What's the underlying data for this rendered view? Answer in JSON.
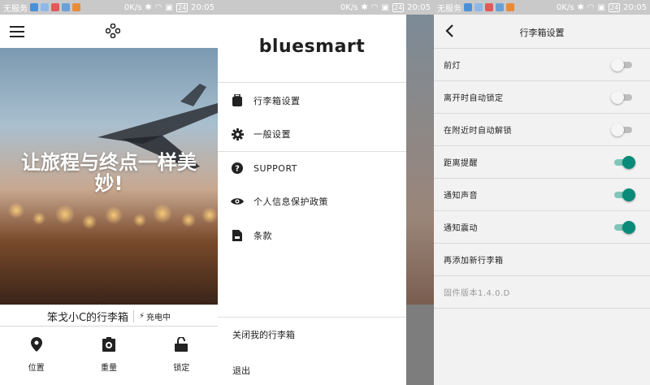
{
  "status": {
    "carrier": "无服务",
    "speed": "0K/s",
    "battery": "24",
    "time": "20:05"
  },
  "colors": {
    "accent": "#0a8a78",
    "accent_track": "#7fc6b9",
    "off_track": "#bdbdbd"
  },
  "home": {
    "hero_text": "让旅程与终点一样美妙!",
    "luggage_name": "笨戈小C的行李箱",
    "charging_label": "充电中",
    "actions": [
      {
        "label": "位置",
        "icon": "location-pin-icon"
      },
      {
        "label": "重量",
        "icon": "scale-icon"
      },
      {
        "label": "锁定",
        "icon": "padlock-icon"
      }
    ]
  },
  "drawer": {
    "brand": "bluesmart",
    "items": [
      {
        "label": "行李箱设置",
        "icon": "luggage-icon"
      },
      {
        "label": "一般设置",
        "icon": "gear-icon"
      },
      {
        "label": "SUPPORT",
        "icon": "help-icon"
      },
      {
        "label": "个人信息保护政策",
        "icon": "eye-icon"
      },
      {
        "label": "条款",
        "icon": "document-icon"
      }
    ],
    "close_luggage": "关闭我的行李箱",
    "logout": "退出"
  },
  "settings": {
    "title": "行李箱设置",
    "rows": [
      {
        "label": "前灯",
        "toggle": false
      },
      {
        "label": "离开时自动锁定",
        "toggle": false
      },
      {
        "label": "在附近时自动解锁",
        "toggle": false
      },
      {
        "label": "距离提醒",
        "toggle": true
      },
      {
        "label": "通知声音",
        "toggle": true
      },
      {
        "label": "通知震动",
        "toggle": true
      }
    ],
    "add_new": "再添加新行李箱",
    "firmware": "固件版本1.4.0.D"
  }
}
